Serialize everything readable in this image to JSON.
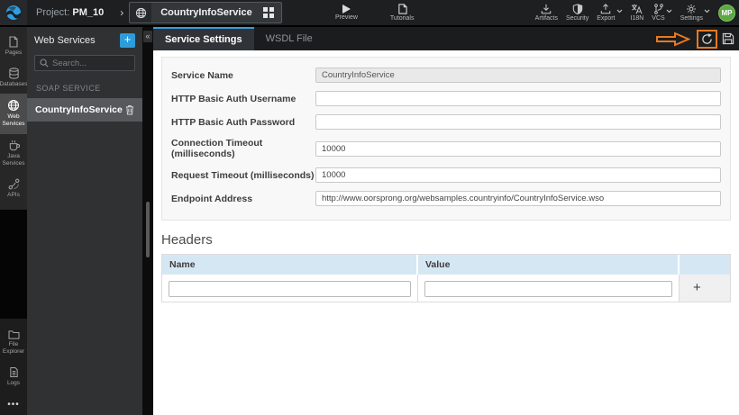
{
  "topbar": {
    "project_label": "Project:",
    "project_name": "PM_10",
    "service_tab": "CountryInfoService",
    "preview": "Preview",
    "tutorials": "Tutorials",
    "artifacts": "Artifacts",
    "security": "Security",
    "export": "Export",
    "i18n": "I18N",
    "vcs": "VCS",
    "settings": "Settings",
    "avatar_initials": "MP"
  },
  "sidebar": {
    "items": [
      {
        "label": "Pages"
      },
      {
        "label": "Databases"
      },
      {
        "label": "Web Services"
      },
      {
        "label": "Java Services"
      },
      {
        "label": "APIs"
      }
    ],
    "bottom_items": [
      {
        "label": "File Explorer"
      },
      {
        "label": "Logs"
      }
    ],
    "more": "•••"
  },
  "panel": {
    "title": "Web Services",
    "add_label": "+",
    "search_placeholder": "Search...",
    "section_label": "SOAP SERVICE",
    "items": [
      {
        "name": "CountryInfoService"
      }
    ],
    "collapse_glyph": "«"
  },
  "tabs": {
    "active": "Service Settings",
    "inactive": "WSDL File"
  },
  "form": {
    "rows": [
      {
        "label": "Service Name",
        "value": "CountryInfoService"
      },
      {
        "label": "HTTP Basic Auth Username",
        "value": ""
      },
      {
        "label": "HTTP Basic Auth Password",
        "value": ""
      },
      {
        "label": "Connection Timeout (milliseconds)",
        "value": "10000"
      },
      {
        "label": "Request Timeout (milliseconds)",
        "value": "10000"
      },
      {
        "label": "Endpoint Address",
        "value": "http://www.oorsprong.org/websamples.countryinfo/CountryInfoService.wso"
      }
    ]
  },
  "headers_section": {
    "title": "Headers",
    "columns": [
      "Name",
      "Value"
    ],
    "add_label": "+",
    "row": {
      "name": "",
      "value": ""
    }
  },
  "colors": {
    "accent_blue": "#2d9cdb",
    "tab_active_border": "#3d9bd6",
    "annotation_orange": "#e8791e",
    "avatar_green": "#5ea746",
    "table_header_bg": "#d6e7f4"
  }
}
